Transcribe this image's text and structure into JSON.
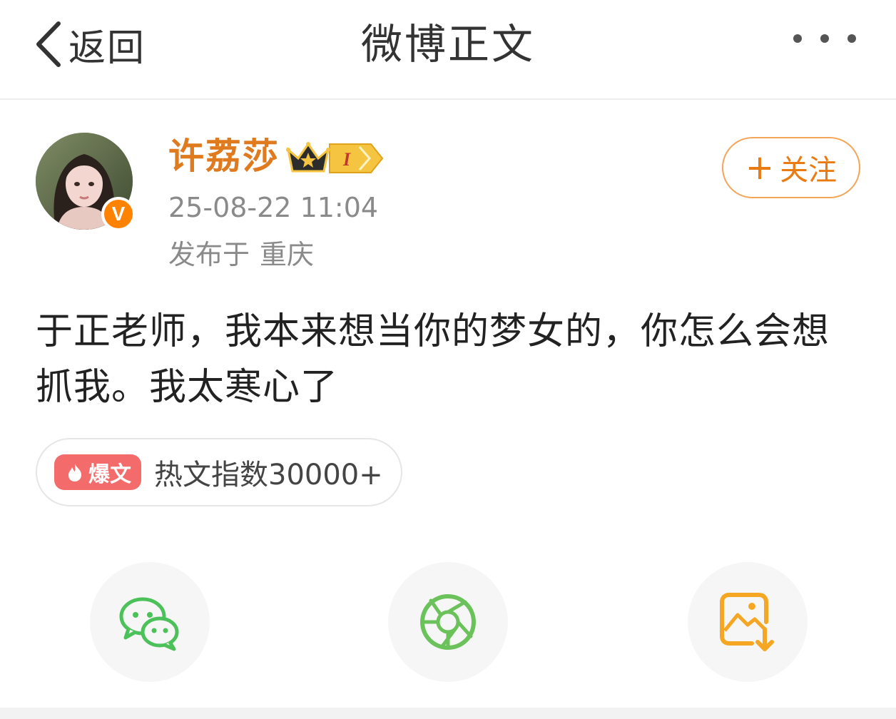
{
  "nav": {
    "back_label": "返回",
    "title": "微博正文",
    "more_icon": "more-dots-icon"
  },
  "author": {
    "name": "许荔莎",
    "verified_badge": "V",
    "vip_level": "I",
    "timestamp": "25-08-22 11:04",
    "location_prefix": "发布于",
    "location": "重庆",
    "follow_label": "+ 关注",
    "follow_text": "关注"
  },
  "post": {
    "text": "于正老师，我本来想当你的梦女的，你怎么会想抓我。我太寒心了"
  },
  "hot": {
    "tag_label": "爆文",
    "text": "热文指数30000+"
  },
  "share": {
    "items": [
      {
        "icon": "wechat-icon",
        "color": "#4cc15a"
      },
      {
        "icon": "moments-icon",
        "color": "#6cc25a"
      },
      {
        "icon": "save-image-icon",
        "color": "#f5a623"
      }
    ]
  },
  "colors": {
    "accent_orange": "#ea7b12",
    "name_orange": "#e07a1f",
    "hot_red": "#f36b6b",
    "muted_text": "#8a8a8a"
  }
}
